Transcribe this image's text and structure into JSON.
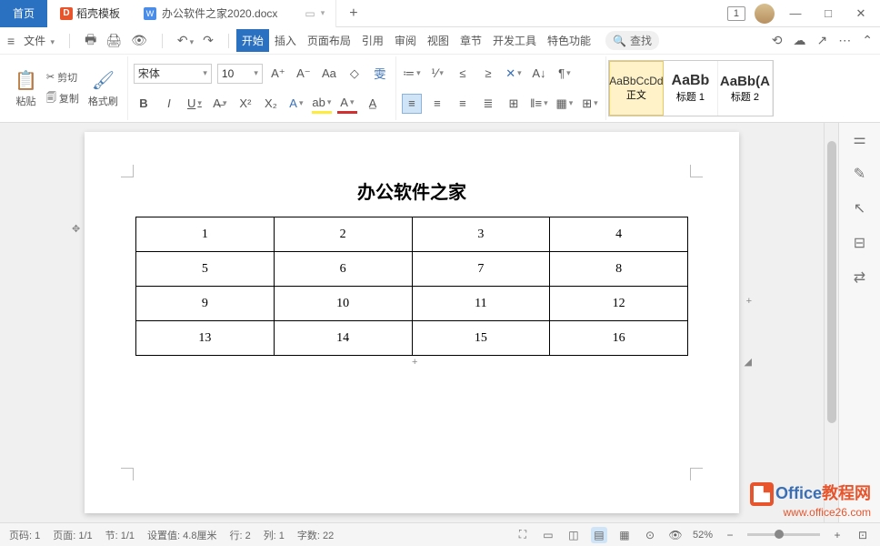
{
  "titlebar": {
    "home_tab": "首页",
    "docer_tab": "稻壳模板",
    "doc_icon": "W",
    "doc_name": "办公软件之家2020.docx",
    "doc_count": "1"
  },
  "menubar": {
    "file": "文件",
    "items": [
      "开始",
      "插入",
      "页面布局",
      "引用",
      "审阅",
      "视图",
      "章节",
      "开发工具",
      "特色功能"
    ],
    "search": "查找"
  },
  "ribbon": {
    "paste": "粘贴",
    "cut": "剪切",
    "copy": "复制",
    "format_painter": "格式刷",
    "font_name": "宋体",
    "font_size": "10",
    "styles": {
      "body": {
        "preview": "AaBbCcDd",
        "label": "正文"
      },
      "h1": {
        "preview": "AaBb",
        "label": "标题 1"
      },
      "h2": {
        "preview": "AaBb(A",
        "label": "标题 2"
      }
    }
  },
  "document": {
    "title": "办公软件之家",
    "table": [
      [
        "1",
        "2",
        "3",
        "4"
      ],
      [
        "5",
        "6",
        "7",
        "8"
      ],
      [
        "9",
        "10",
        "11",
        "12"
      ],
      [
        "13",
        "14",
        "15",
        "16"
      ]
    ]
  },
  "statusbar": {
    "page_no": "页码: 1",
    "page_of": "页面: 1/1",
    "section": "节: 1/1",
    "setting": "设置值: 4.8厘米",
    "line": "行: 2",
    "col": "列: 1",
    "words": "字数: 22",
    "zoom": "52%"
  },
  "watermark": {
    "brand": "Office",
    "suffix": "教程网",
    "url": "www.office26.com"
  }
}
